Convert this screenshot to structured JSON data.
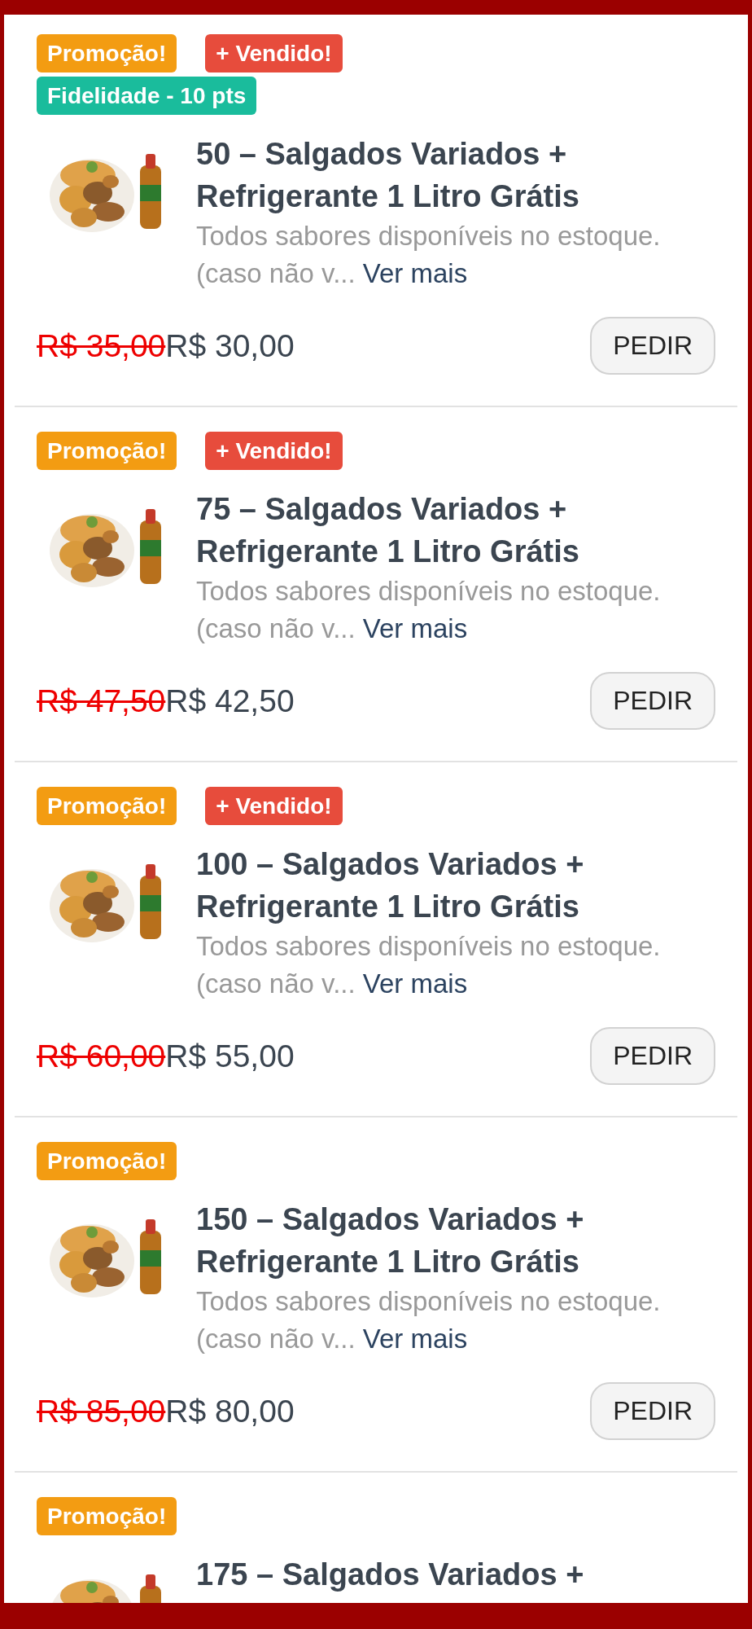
{
  "products": [
    {
      "badges": [
        {
          "kind": "promo",
          "label": "Promoção!"
        },
        {
          "kind": "bestseller",
          "label": "+ Vendido!"
        },
        {
          "kind": "loyalty",
          "label": "Fidelidade - 10 pts"
        }
      ],
      "title": "50 – Salgados Variados + Refrigerante 1 Litro Grátis",
      "description": "Todos sabores disponíveis no estoque. (caso não v...",
      "more_link": "Ver mais",
      "old_price": "R$ 35,00",
      "price": "R$ 30,00",
      "button": "PEDIR"
    },
    {
      "badges": [
        {
          "kind": "promo",
          "label": "Promoção!"
        },
        {
          "kind": "bestseller",
          "label": "+ Vendido!"
        }
      ],
      "title": "75 – Salgados Variados + Refrigerante 1 Litro Grátis",
      "description": "Todos sabores disponíveis no estoque. (caso não v...",
      "more_link": "Ver mais",
      "old_price": "R$ 47,50",
      "price": "R$ 42,50",
      "button": "PEDIR"
    },
    {
      "badges": [
        {
          "kind": "promo",
          "label": "Promoção!"
        },
        {
          "kind": "bestseller",
          "label": "+ Vendido!"
        }
      ],
      "title": "100 – Salgados Variados + Refrigerante 1 Litro Grátis",
      "description": "Todos sabores disponíveis no estoque. (caso não v...",
      "more_link": "Ver mais",
      "old_price": "R$ 60,00",
      "price": "R$ 55,00",
      "button": "PEDIR"
    },
    {
      "badges": [
        {
          "kind": "promo",
          "label": "Promoção!"
        }
      ],
      "title": "150 – Salgados Variados + Refrigerante 1 Litro Grátis",
      "description": "Todos sabores disponíveis no estoque. (caso não v...",
      "more_link": "Ver mais",
      "old_price": "R$ 85,00",
      "price": "R$ 80,00",
      "button": "PEDIR"
    },
    {
      "badges": [
        {
          "kind": "promo",
          "label": "Promoção!"
        }
      ],
      "title": "175 – Salgados Variados +"
    }
  ]
}
